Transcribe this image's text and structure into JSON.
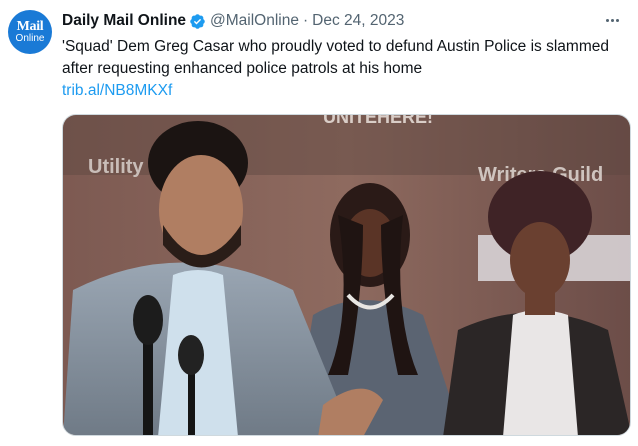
{
  "author": {
    "display_name": "Daily Mail Online",
    "handle": "@MailOnline",
    "separator": "·",
    "date": "Dec 24, 2023",
    "avatar_logo_top": "Mail",
    "avatar_logo_bottom": "Online",
    "verified": true
  },
  "tweet": {
    "text": "'Squad' Dem Greg Casar who proudly voted to defund Austin Police is slammed after requesting enhanced police patrols at his home",
    "link": "trib.al/NB8MKXf"
  },
  "media": {
    "backdrop_words": [
      "Utility",
      "Writers Guild",
      "UNITEHERE!"
    ]
  },
  "colors": {
    "accent": "#1d9bf0",
    "secondary_text": "#536471",
    "avatar_bg": "#1a7ad6"
  }
}
